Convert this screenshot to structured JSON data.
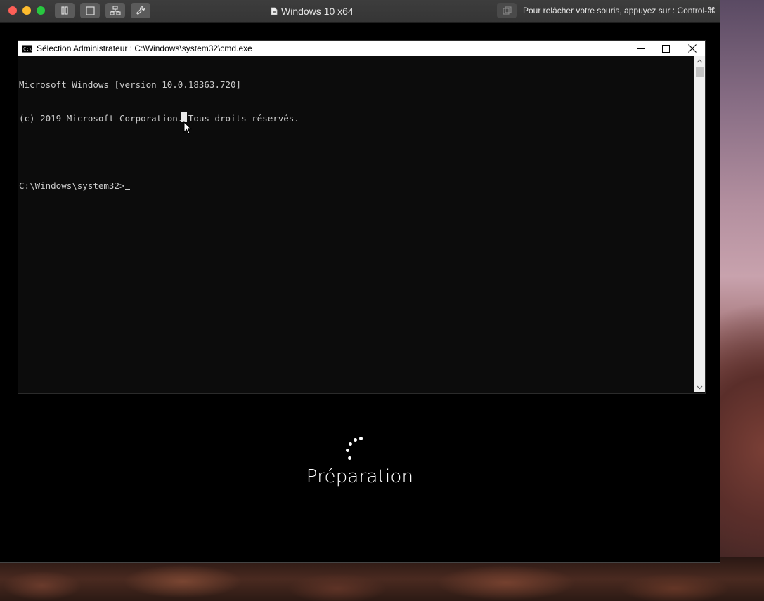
{
  "vm": {
    "title": "Windows 10 x64",
    "release_hint": "Pour relâcher votre souris, appuyez sur : Control-⌘",
    "toolbar_icons": [
      "pause-icon",
      "window-icon",
      "network-icon",
      "wrench-icon"
    ]
  },
  "cmd": {
    "title": "Sélection Administrateur : C:\\Windows\\system32\\cmd.exe",
    "lines": [
      "Microsoft Windows [version 10.0.18363.720]",
      "(c) 2019 Microsoft Corporation. Tous droits réservés.",
      "",
      "C:\\Windows\\system32>"
    ]
  },
  "setup": {
    "status": "Préparation"
  },
  "colors": {
    "console_bg": "#0c0c0c",
    "console_text": "#cccccc",
    "vm_titlebar": "#3a3a3a"
  }
}
